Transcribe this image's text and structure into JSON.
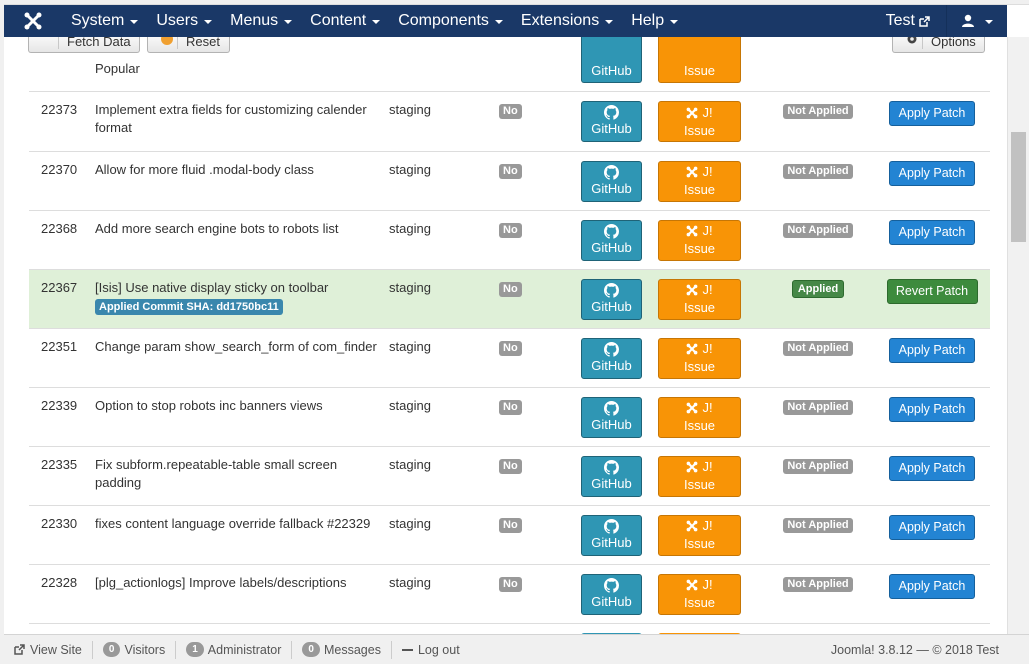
{
  "nav": {
    "menus": [
      "System",
      "Users",
      "Menus",
      "Content",
      "Components",
      "Extensions",
      "Help"
    ],
    "user": "Test"
  },
  "toolbar": {
    "fetch_label": "Fetch Data",
    "reset_label": "Reset",
    "options_label": "Options"
  },
  "partial_row": {
    "title": "Popular",
    "github_label": "GitHub",
    "issue_label": "Issue"
  },
  "labels": {
    "rtc_no": "No",
    "not_applied": "Not Applied",
    "applied": "Applied",
    "github": "GitHub",
    "issue_j": "J!",
    "issue": "Issue",
    "apply_patch": "Apply Patch",
    "revert_patch": "Revert Patch"
  },
  "rows": [
    {
      "id": "22373",
      "title": "Implement extra fields for customizing calender format",
      "branch": "staging",
      "status": "not_applied"
    },
    {
      "id": "22370",
      "title": "Allow for more fluid .modal-body class",
      "branch": "staging",
      "status": "not_applied"
    },
    {
      "id": "22368",
      "title": "Add more search engine bots to robots list",
      "branch": "staging",
      "status": "not_applied"
    },
    {
      "id": "22367",
      "title": "[Isis] Use native display sticky on toolbar",
      "branch": "staging",
      "status": "applied",
      "sha": "Applied Commit SHA: dd1750bc11"
    },
    {
      "id": "22351",
      "title": "Change param show_search_form of com_finder",
      "branch": "staging",
      "status": "not_applied"
    },
    {
      "id": "22339",
      "title": "Option to stop robots inc banners views",
      "branch": "staging",
      "status": "not_applied"
    },
    {
      "id": "22335",
      "title": "Fix subform.repeatable-table small screen padding",
      "branch": "staging",
      "status": "not_applied"
    },
    {
      "id": "22330",
      "title": "fixes content language override fallback #22329",
      "branch": "staging",
      "status": "not_applied"
    },
    {
      "id": "22328",
      "title": "[plg_actionlogs] Improve labels/descriptions",
      "branch": "staging",
      "status": "not_applied"
    }
  ],
  "footer": {
    "view_site": "View Site",
    "visitors_count": "0",
    "visitors_label": "Visitors",
    "admin_count": "1",
    "admin_label": "Administrator",
    "messages_count": "0",
    "messages_label": "Messages",
    "logout": "Log out",
    "version": "Joomla! 3.8.12 — © 2018 Test"
  },
  "colors": {
    "navbar": "#1a3867",
    "github_btn": "#2f96b4",
    "issue_btn": "#f89406",
    "apply_btn": "#2384d3",
    "revert_btn": "#3d8b3d",
    "applied_row": "#dff0d8"
  }
}
